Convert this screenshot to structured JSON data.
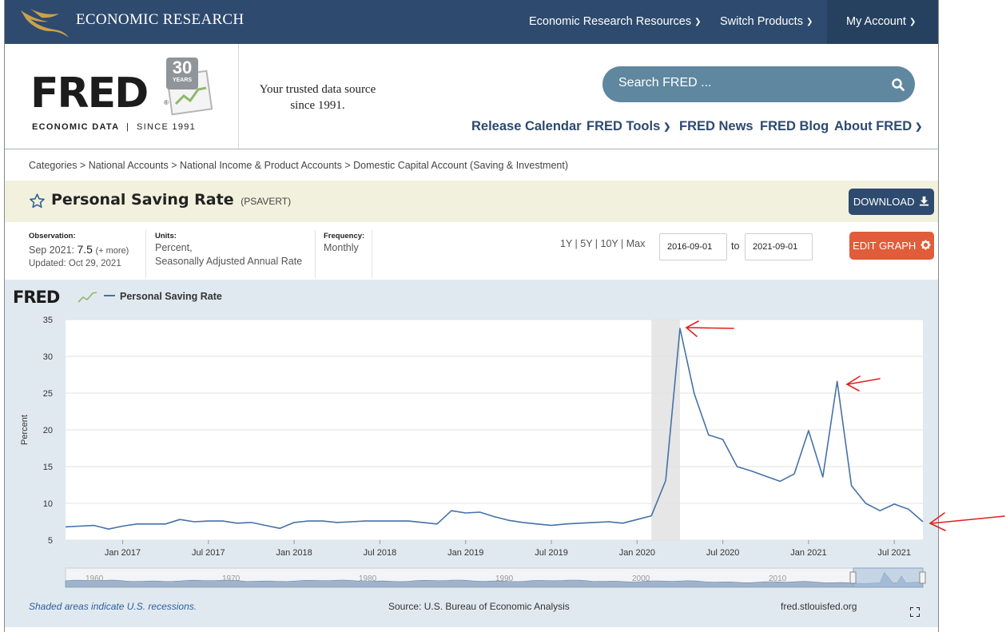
{
  "topbar": {
    "brand": "ECONOMIC RESEARCH",
    "nav": [
      "Economic Research Resources",
      "Switch Products",
      "My Account"
    ]
  },
  "header": {
    "logo_text": "FRED",
    "logo_sub": "ECONOMIC DATA  |  SINCE 1991",
    "badge_number": "30",
    "badge_label": "YEARS",
    "tagline": "Your trusted data source since 1991.",
    "search_placeholder": "Search FRED ...",
    "nav": [
      "Release Calendar",
      "FRED Tools",
      "FRED News",
      "FRED Blog",
      "About FRED"
    ]
  },
  "breadcrumb": "Categories > National Accounts > National Income & Product Accounts > Domestic Capital Account (Saving & Investment)",
  "series": {
    "title": "Personal Saving Rate",
    "id": "(PSAVERT)",
    "download_label": "DOWNLOAD"
  },
  "meta": {
    "observation_label": "Observation:",
    "observation_date": "Sep 2021:",
    "observation_value": "7.5",
    "observation_more": "(+ more)",
    "updated": "Updated: Oct 29, 2021",
    "units_label": "Units:",
    "units_line1": "Percent,",
    "units_line2": "Seasonally Adjusted Annual Rate",
    "frequency_label": "Frequency:",
    "frequency": "Monthly",
    "ranges": "1Y | 5Y | 10Y | Max",
    "date_from": "2016-09-01",
    "to_label": "to",
    "date_to": "2021-09-01",
    "edit_label": "EDIT GRAPH"
  },
  "colors": {
    "navy": "#2e4a6e",
    "series": "#4572a7",
    "edit": "#e05c3a",
    "annotation": "#e02020"
  },
  "chart_data": {
    "type": "line",
    "legend": "Personal Saving Rate",
    "ylabel": "Percent",
    "ylim": [
      5,
      35
    ],
    "yticks": [
      5,
      10,
      15,
      20,
      25,
      30,
      35
    ],
    "xticks": [
      "Jan 2017",
      "Jul 2017",
      "Jan 2018",
      "Jul 2018",
      "Jan 2019",
      "Jul 2019",
      "Jan 2020",
      "Jul 2020",
      "Jan 2021",
      "Jul 2021"
    ],
    "recession": [
      "2020-02",
      "2020-04"
    ],
    "x": [
      "2016-09",
      "2016-10",
      "2016-11",
      "2016-12",
      "2017-01",
      "2017-02",
      "2017-03",
      "2017-04",
      "2017-05",
      "2017-06",
      "2017-07",
      "2017-08",
      "2017-09",
      "2017-10",
      "2017-11",
      "2017-12",
      "2018-01",
      "2018-02",
      "2018-03",
      "2018-04",
      "2018-05",
      "2018-06",
      "2018-07",
      "2018-08",
      "2018-09",
      "2018-10",
      "2018-11",
      "2018-12",
      "2019-01",
      "2019-02",
      "2019-03",
      "2019-04",
      "2019-05",
      "2019-06",
      "2019-07",
      "2019-08",
      "2019-09",
      "2019-10",
      "2019-11",
      "2019-12",
      "2020-01",
      "2020-02",
      "2020-03",
      "2020-04",
      "2020-05",
      "2020-06",
      "2020-07",
      "2020-08",
      "2020-09",
      "2020-10",
      "2020-11",
      "2020-12",
      "2021-01",
      "2021-02",
      "2021-03",
      "2021-04",
      "2021-05",
      "2021-06",
      "2021-07",
      "2021-08",
      "2021-09"
    ],
    "values": [
      6.8,
      6.9,
      7.0,
      6.5,
      6.9,
      7.2,
      7.2,
      7.2,
      7.8,
      7.5,
      7.6,
      7.6,
      7.3,
      7.4,
      7.0,
      6.6,
      7.4,
      7.6,
      7.6,
      7.4,
      7.5,
      7.6,
      7.6,
      7.6,
      7.6,
      7.4,
      7.2,
      9.0,
      8.7,
      8.8,
      8.2,
      7.7,
      7.4,
      7.2,
      7.0,
      7.2,
      7.3,
      7.4,
      7.5,
      7.3,
      7.8,
      8.3,
      13.1,
      33.8,
      24.9,
      19.3,
      18.7,
      15.0,
      14.4,
      13.7,
      13.0,
      14.0,
      19.9,
      13.6,
      26.6,
      12.4,
      10.0,
      9.0,
      9.9,
      9.2,
      7.5
    ],
    "minimap_labels": [
      "1960",
      "1970",
      "1980",
      "1990",
      "2000",
      "2010"
    ],
    "footer_note": "Shaded areas indicate U.S. recessions.",
    "source": "Source: U.S. Bureau of Economic Analysis",
    "site": "fred.stlouisfed.org"
  }
}
